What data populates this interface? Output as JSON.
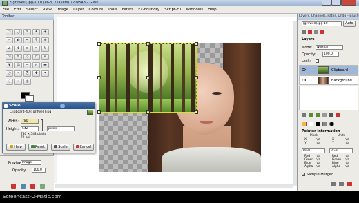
{
  "window": {
    "title": "*[grifwell].jpg-10.0 (RGB, 2 layers) 720x543 – GIMP",
    "colors": {
      "titlebar": "#b5c6dc",
      "menubar": "#ecebe6",
      "selection": "#e8e000",
      "dialog_header": "#2b5286"
    }
  },
  "menu": [
    "File",
    "Edit",
    "Select",
    "View",
    "Image",
    "Layer",
    "Colours",
    "Tools",
    "Filters",
    "FX-Foundry",
    "Script-Fu",
    "Windows",
    "Help"
  ],
  "toolbox": {
    "title": "Toolbox",
    "tools": [
      "rect-select",
      "ellipse-select",
      "free-select",
      "fuzzy-select",
      "color-select",
      "scissors",
      "foreground-select",
      "paths",
      "color-picker",
      "zoom",
      "measure",
      "move",
      "align",
      "crop",
      "rotate",
      "scale",
      "shear",
      "perspective",
      "flip",
      "text",
      "bucket-fill",
      "blend",
      "pencil",
      "paintbrush",
      "eraser",
      "airbrush",
      "ink",
      "clone",
      "heal",
      "perspective-clone",
      "convolve",
      "smudge",
      "dodge-burn"
    ],
    "options": {
      "preview_label": "Preview",
      "preview_value": "Image",
      "opacity_label": "Opacity:",
      "opacity_value": "100.0"
    }
  },
  "scale_dialog": {
    "title": "Scale",
    "subtitle": "Clipboard-40 ([grifwell].jpg)",
    "width_label": "Width:",
    "width_value": "780",
    "height_label": "Height:",
    "height_value": "542",
    "unit": "pixels",
    "size_info": "780 × 542 pixels",
    "res_info": "72 ppi",
    "buttons": {
      "help": "Help",
      "reset": "Reset",
      "scale": "Scale",
      "cancel": "Cancel"
    }
  },
  "dock": {
    "title": "Layers, Channels, Paths, Undo – Brushes",
    "image_select": "[grifwell].jpg-10",
    "auto_label": "Auto",
    "layers_title": "Layers",
    "mode_label": "Mode:",
    "mode_value": "Normal",
    "opacity_label": "Opacity:",
    "opacity_value": "100.0",
    "lock_label": "Lock:",
    "layers": [
      {
        "name": "Clipboard",
        "selected": true
      },
      {
        "name": "Background",
        "selected": false
      }
    ],
    "pointer": {
      "title": "Pointer Information",
      "headers": [
        "Pixels",
        "Units"
      ],
      "rows": [
        [
          "X",
          "n/a",
          "X",
          "n/a"
        ],
        [
          "Y",
          "n/a",
          "Y",
          "n/a"
        ]
      ],
      "pixel_label": "Pixel",
      "rgb_label": "RGB",
      "color_rows": [
        [
          "Red",
          "n/a",
          "Red",
          "n/a"
        ],
        [
          "Green",
          "n/a",
          "Green",
          "n/a"
        ],
        [
          "Blue",
          "n/a",
          "Blue",
          "n/a"
        ],
        [
          "Alpha",
          "n/a",
          "Alpha",
          "n/a"
        ]
      ],
      "sample_merged": "Sample Merged"
    }
  },
  "watermark": "Screencast-O-Matic.com"
}
